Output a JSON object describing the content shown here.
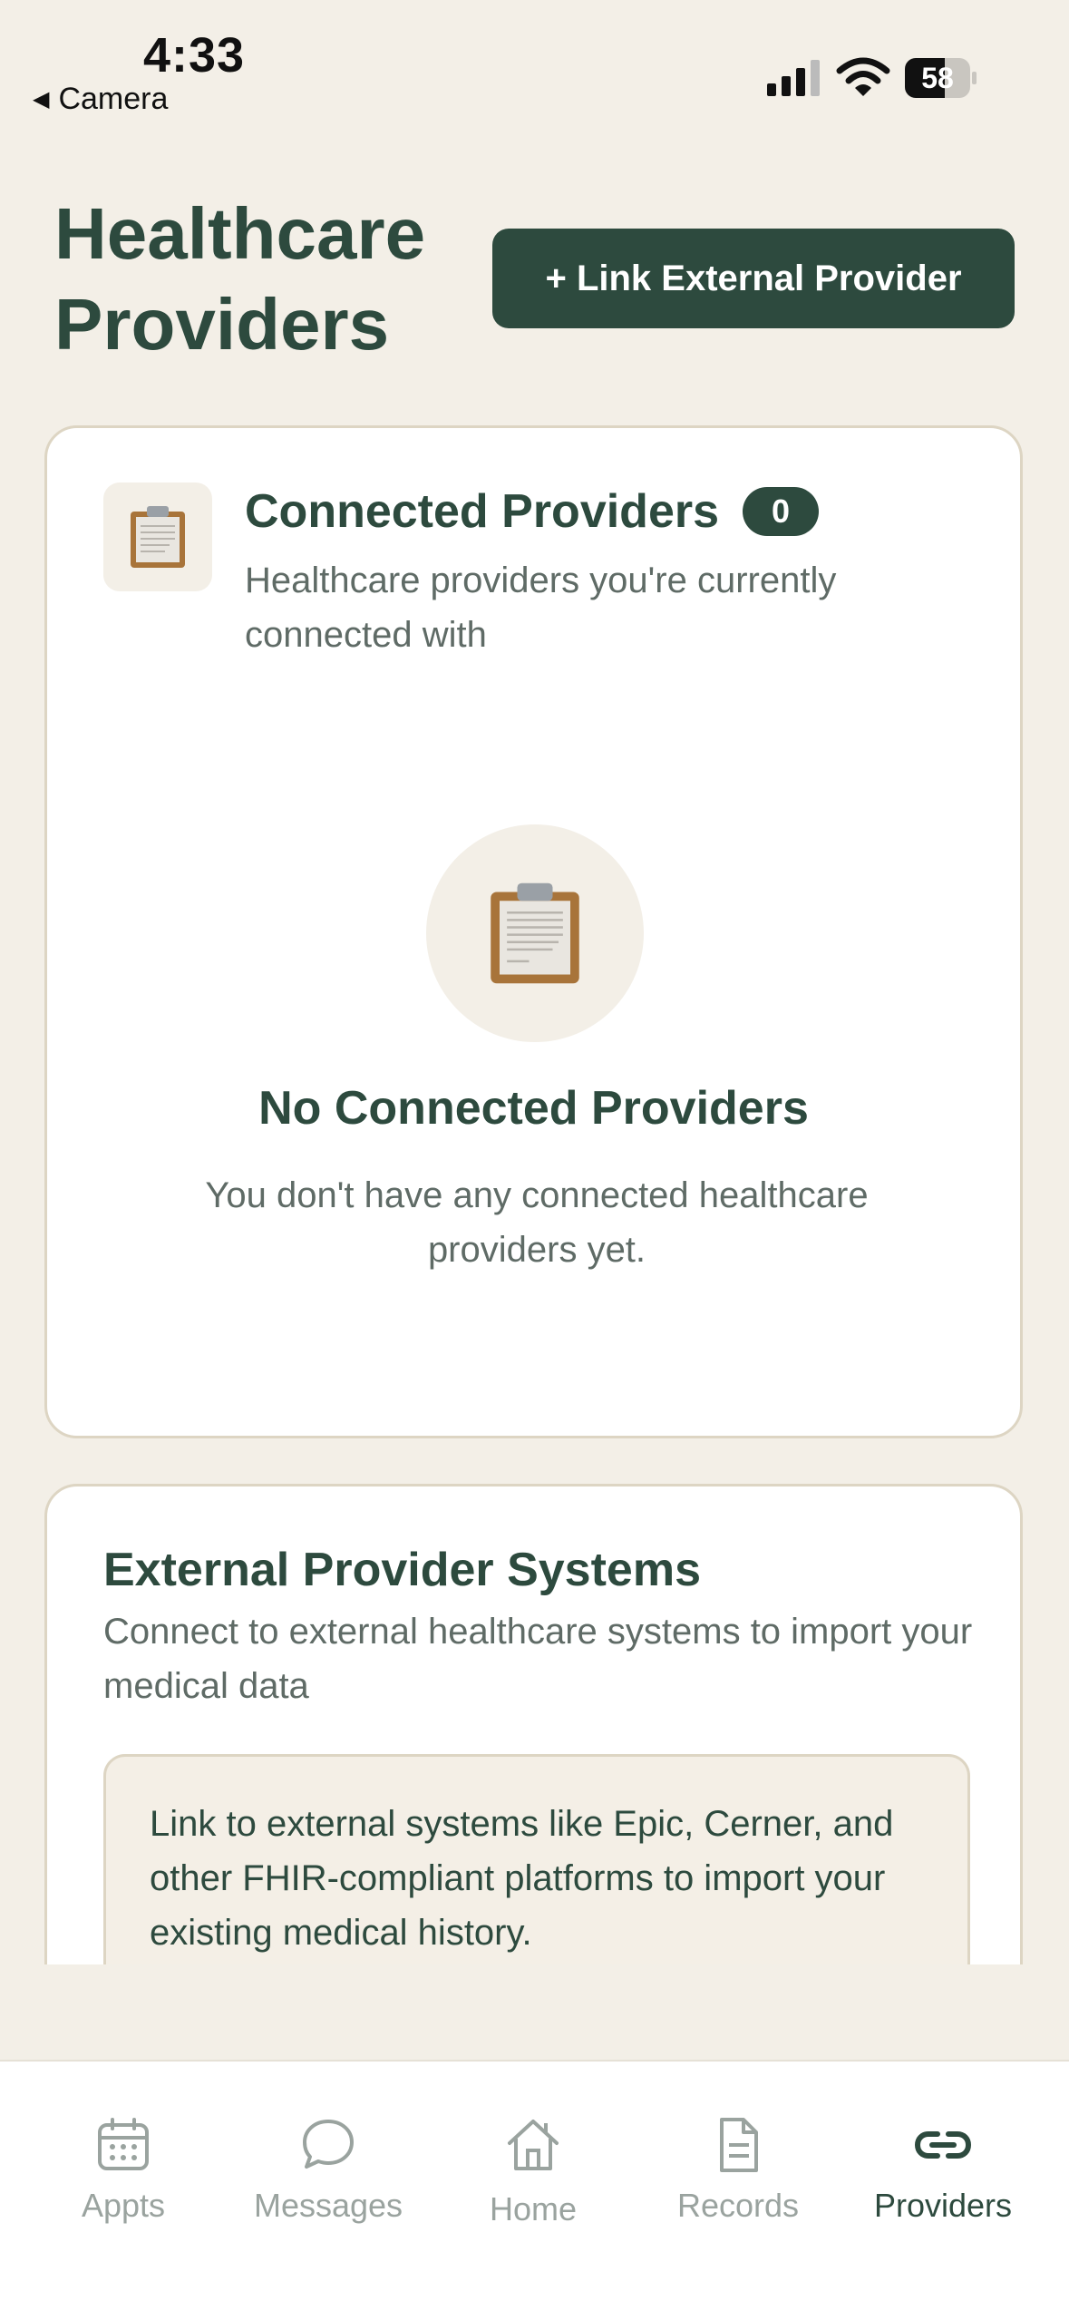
{
  "status_bar": {
    "time": "4:33",
    "back_app": "Camera",
    "battery": "58"
  },
  "header": {
    "title": "Healthcare Providers",
    "link_button": "+ Link External Provider"
  },
  "connected": {
    "title": "Connected Providers",
    "count": "0",
    "subtitle": "Healthcare providers you're currently connected with",
    "icon": "clipboard-icon",
    "empty_title": "No Connected Providers",
    "empty_text": "You don't have any connected healthcare providers yet."
  },
  "external": {
    "title": "External Provider Systems",
    "subtitle": "Connect to external healthcare systems to import your medical data",
    "info": "Link to external systems like Epic, Cerner, and other FHIR-compliant platforms to import your existing medical history."
  },
  "tabs": [
    {
      "label": "Appts",
      "icon": "calendar-icon"
    },
    {
      "label": "Messages",
      "icon": "chat-bubble-icon"
    },
    {
      "label": "Home",
      "icon": "home-icon"
    },
    {
      "label": "Records",
      "icon": "document-icon"
    },
    {
      "label": "Providers",
      "icon": "link-icon",
      "active": true
    }
  ],
  "colors": {
    "primary": "#2d4a3e",
    "background": "#f3efe7",
    "muted": "#5f6b66",
    "inactive_tab": "#9aa39f"
  }
}
